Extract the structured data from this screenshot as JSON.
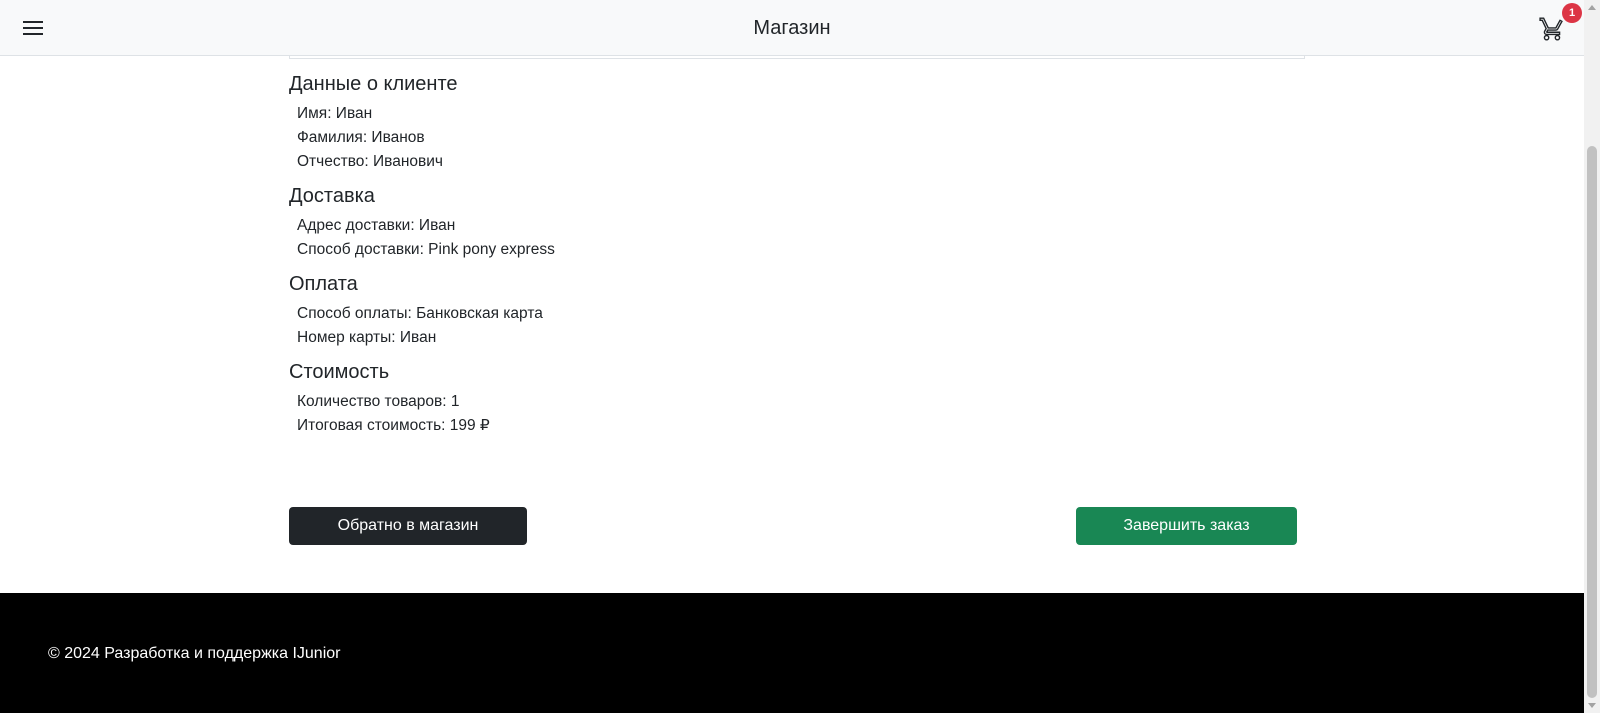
{
  "navbar": {
    "title": "Магазин",
    "menu_icon": "hamburger-menu-icon",
    "cart_icon": "shopping-cart-icon",
    "cart_count": "1",
    "badge_color": "#dc3545"
  },
  "customer": {
    "heading": "Данные о клиенте",
    "first_name": "Имя: Иван",
    "last_name": "Фамилия: Иванов",
    "patronymic": "Отчество: Иванович"
  },
  "delivery": {
    "heading": "Доставка",
    "address": "Адрес доставки: Иван",
    "method": "Способ доставки: Pink pony express"
  },
  "payment": {
    "heading": "Оплата",
    "method": "Способ оплаты: Банковская карта",
    "card_number": "Номер карты: Иван"
  },
  "cost": {
    "heading": "Стоимость",
    "item_count": "Количество товаров: 1",
    "total": "Итоговая стоимость: 199 ₽"
  },
  "actions": {
    "back_label": "Обратно в магазин",
    "back_color": "#212529",
    "finish_label": "Завершить заказ",
    "finish_color": "#198754"
  },
  "footer": {
    "text": "© 2024 Разработка и поддержка IJunior"
  }
}
